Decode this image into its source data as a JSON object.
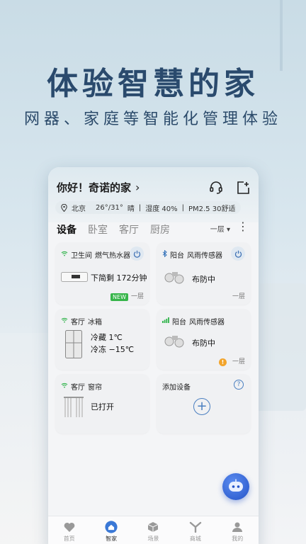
{
  "promo": {
    "headline": "体验智慧的家",
    "subheadline": "网器、家庭等智能化管理体验"
  },
  "header": {
    "greeting": "你好！奇诺的家",
    "chevron": "›",
    "weather": {
      "city": "北京",
      "temp": "26°/31°",
      "condition": "晴",
      "humidity": "湿度 40%",
      "air": "PM2.5 30舒适"
    }
  },
  "tabs": [
    {
      "label": "设备",
      "active": true
    },
    {
      "label": "卧室",
      "active": false
    },
    {
      "label": "客厅",
      "active": false
    },
    {
      "label": "厨房",
      "active": false
    }
  ],
  "floor_select": "一层 ▾",
  "more_glyph": "⋮",
  "devices": {
    "water_heater": {
      "room": "卫生间",
      "name": "燃气热水器",
      "status": "下简剩 172分钟",
      "badge": "NEW",
      "floor": "一层"
    },
    "rain_sensor_1": {
      "room": "阳台",
      "name": "风雨传感器",
      "status": "布防中",
      "floor": "一层"
    },
    "fridge": {
      "room": "客厅",
      "name": "冰箱",
      "status_line1": "冷藏 1℃",
      "status_line2": "冷冻 −15℃"
    },
    "rain_sensor_2": {
      "room": "阳台",
      "name": "风雨传感器",
      "status": "布防中",
      "warn": "!",
      "floor": "一层"
    },
    "curtain": {
      "room": "客厅",
      "name": "窗帘",
      "status": "已打开"
    },
    "add_device": {
      "label": "添加设备",
      "help": "?",
      "plus": "+"
    }
  },
  "bottom_nav": [
    {
      "label": "首页",
      "icon": "heart-icon",
      "active": false
    },
    {
      "label": "智家",
      "icon": "home-icon",
      "active": true
    },
    {
      "label": "场景",
      "icon": "cube-icon",
      "active": false
    },
    {
      "label": "商城",
      "icon": "shop-icon",
      "active": false
    },
    {
      "label": "我的",
      "icon": "profile-icon",
      "active": false
    }
  ],
  "colors": {
    "accent": "#4a7fc0",
    "headline": "#2a4a6d",
    "online": "#2fb34a",
    "new_badge": "#37b54a"
  }
}
